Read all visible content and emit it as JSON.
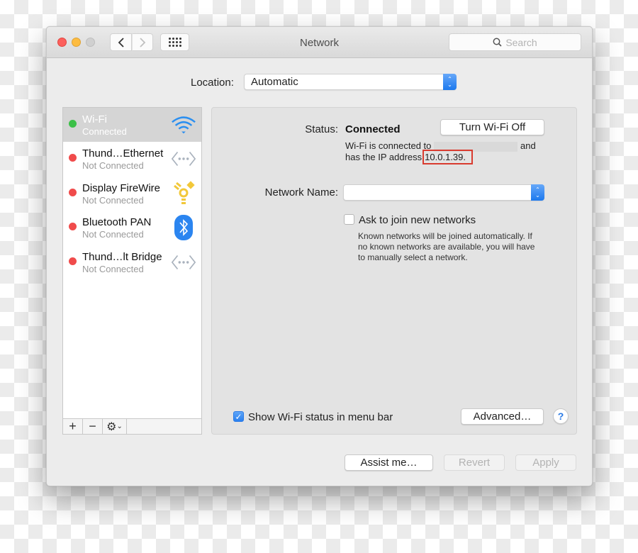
{
  "window": {
    "title": "Network",
    "search_placeholder": "Search"
  },
  "location": {
    "label": "Location:",
    "value": "Automatic"
  },
  "services": [
    {
      "name": "Wi-Fi",
      "status": "Connected",
      "status_color": "#3cc048",
      "icon": "wifi-icon",
      "selected": true
    },
    {
      "name": "Thund…Ethernet",
      "status": "Not Connected",
      "status_color": "#f04b4b",
      "icon": "ethernet-icon",
      "selected": false
    },
    {
      "name": "Display FireWire",
      "status": "Not Connected",
      "status_color": "#f04b4b",
      "icon": "firewire-icon",
      "selected": false
    },
    {
      "name": "Bluetooth PAN",
      "status": "Not Connected",
      "status_color": "#f04b4b",
      "icon": "bluetooth-icon",
      "selected": false
    },
    {
      "name": "Thund…lt Bridge",
      "status": "Not Connected",
      "status_color": "#f04b4b",
      "icon": "ethernet-icon",
      "selected": false
    }
  ],
  "sidebar_tools": {
    "add": "+",
    "remove": "−",
    "gear": "⚙"
  },
  "detail": {
    "status_label": "Status:",
    "status_value": "Connected",
    "toggle_button": "Turn Wi-Fi Off",
    "desc_line1_prefix": "Wi-Fi is connected to",
    "desc_line1_suffix": "and",
    "desc_line2_prefix": "has the IP address",
    "ip_address": "10.0.1.39.",
    "network_name_label": "Network Name:",
    "network_name_value": "",
    "ask_join_label": "Ask to join new networks",
    "ask_join_checked": false,
    "ask_join_help": [
      "Known networks will be joined automatically. If",
      "no known networks are available, you will have",
      "to manually select a network."
    ],
    "show_status_label": "Show Wi-Fi status in menu bar",
    "show_status_checked": true,
    "advanced_button": "Advanced…",
    "help_button": "?"
  },
  "footer": {
    "assist_button": "Assist me…",
    "revert_button": "Revert",
    "apply_button": "Apply"
  }
}
